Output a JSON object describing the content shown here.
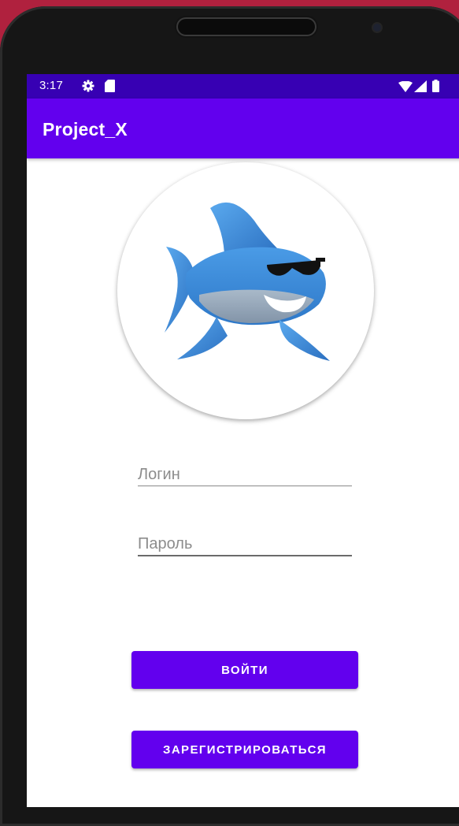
{
  "status_bar": {
    "time": "3:17",
    "icons": [
      "gear-icon",
      "sd-card-icon",
      "wifi-icon",
      "signal-icon",
      "battery-icon"
    ]
  },
  "app_bar": {
    "title": "Project_X"
  },
  "logo": {
    "icon": "shark-logo-icon"
  },
  "login_form": {
    "login_placeholder": "Логин",
    "login_value": "",
    "password_placeholder": "Пароль",
    "password_value": ""
  },
  "buttons": {
    "login_label": "ВОЙТИ",
    "register_label": "ЗАРЕГИСТРИРОВАТЬСЯ"
  },
  "colors": {
    "status_bar": "#3700b3",
    "primary": "#6200ee",
    "background_outer": "#b0213e",
    "device": "#161616"
  }
}
